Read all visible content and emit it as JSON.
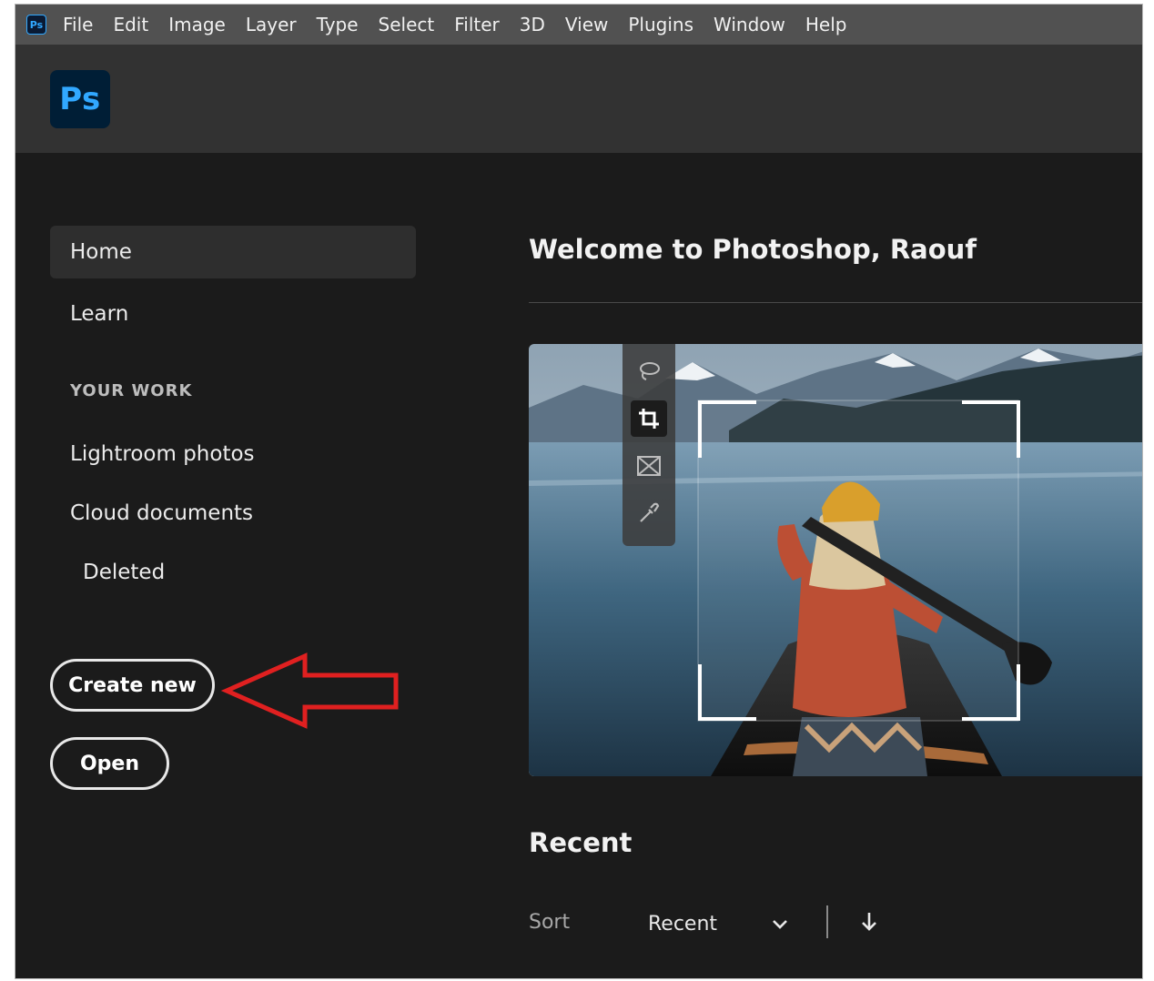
{
  "menubar": {
    "logo": "Ps",
    "items": [
      "File",
      "Edit",
      "Image",
      "Layer",
      "Type",
      "Select",
      "Filter",
      "3D",
      "View",
      "Plugins",
      "Window",
      "Help"
    ]
  },
  "header": {
    "logo": "Ps"
  },
  "sidebar": {
    "home": "Home",
    "learn": "Learn",
    "section": "YOUR WORK",
    "lightroom": "Lightroom photos",
    "cloud": "Cloud documents",
    "deleted": "Deleted"
  },
  "buttons": {
    "create": "Create new",
    "open": "Open"
  },
  "main": {
    "welcome": "Welcome to Photoshop, Raouf",
    "recent_heading": "Recent",
    "sort_label": "Sort",
    "sort_value": "Recent"
  },
  "hero_tools": [
    "lasso-icon",
    "crop-icon",
    "frame-icon",
    "eyedropper-icon"
  ],
  "colors": {
    "brand": "#31a8ff",
    "background": "#1b1b1b",
    "annotation": "#e02020"
  }
}
